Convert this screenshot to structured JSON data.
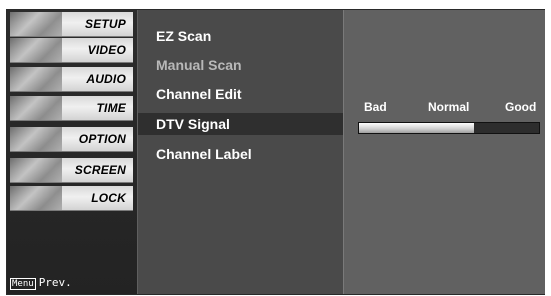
{
  "menu": {
    "categories": [
      {
        "label": "SETUP"
      },
      {
        "label": "VIDEO"
      },
      {
        "label": "AUDIO"
      },
      {
        "label": "TIME"
      },
      {
        "label": "OPTION"
      },
      {
        "label": "SCREEN"
      },
      {
        "label": "LOCK"
      }
    ],
    "hint": {
      "key": "Menu",
      "text": "Prev."
    }
  },
  "options": {
    "items": [
      {
        "label": "EZ Scan",
        "state": "normal"
      },
      {
        "label": "Manual Scan",
        "state": "dimmed"
      },
      {
        "label": "Channel Edit",
        "state": "normal"
      },
      {
        "label": "DTV Signal",
        "state": "selected"
      },
      {
        "label": "Channel Label",
        "state": "normal"
      }
    ]
  },
  "signal": {
    "labels": {
      "bad": "Bad",
      "normal": "Normal",
      "good": "Good"
    },
    "level_fraction": 0.64
  }
}
